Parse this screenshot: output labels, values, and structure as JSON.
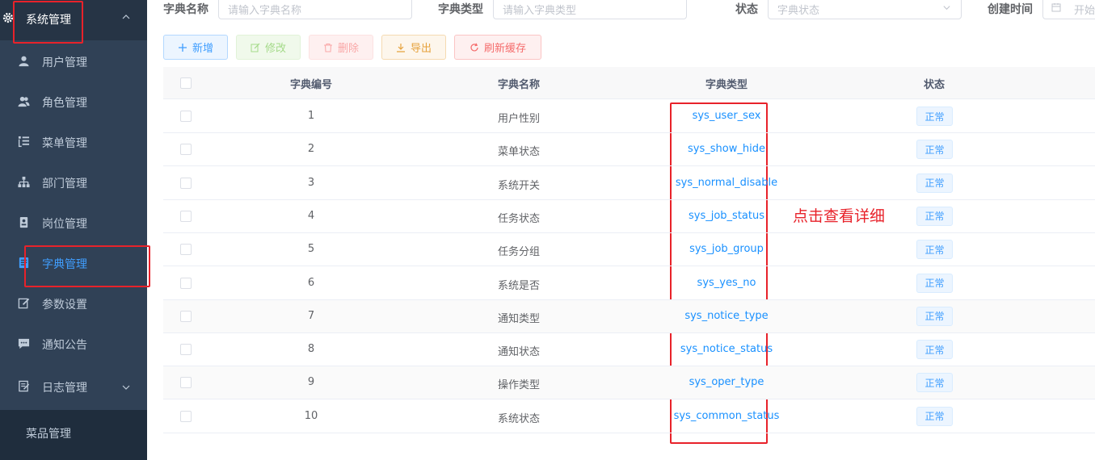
{
  "sidebar": {
    "header": "系统管理",
    "items": [
      {
        "label": "用户管理",
        "icon": "user-icon"
      },
      {
        "label": "角色管理",
        "icon": "peoples-icon"
      },
      {
        "label": "菜单管理",
        "icon": "tree-table-icon"
      },
      {
        "label": "部门管理",
        "icon": "tree-icon"
      },
      {
        "label": "岗位管理",
        "icon": "post-icon"
      },
      {
        "label": "字典管理",
        "icon": "dict-icon",
        "active": true
      },
      {
        "label": "参数设置",
        "icon": "edit-icon"
      },
      {
        "label": "通知公告",
        "icon": "message-icon"
      },
      {
        "label": "日志管理",
        "icon": "log-icon"
      }
    ],
    "submenu": "菜品管理"
  },
  "filters": {
    "dict_name_label": "字典名称",
    "dict_name_placeholder": "请输入字典名称",
    "dict_type_label": "字典类型",
    "dict_type_placeholder": "请输入字典类型",
    "status_label": "状态",
    "status_placeholder": "字典状态",
    "created_label": "创建时间",
    "created_placeholder": "开始"
  },
  "toolbar": {
    "add": "新增",
    "edit": "修改",
    "delete": "删除",
    "export": "导出",
    "refresh": "刷新缓存"
  },
  "table": {
    "headers": [
      "字典编号",
      "字典名称",
      "字典类型",
      "状态"
    ],
    "rows": [
      {
        "id": "1",
        "name": "用户性别",
        "type": "sys_user_sex",
        "status": "正常"
      },
      {
        "id": "2",
        "name": "菜单状态",
        "type": "sys_show_hide",
        "status": "正常"
      },
      {
        "id": "3",
        "name": "系统开关",
        "type": "sys_normal_disable",
        "status": "正常"
      },
      {
        "id": "4",
        "name": "任务状态",
        "type": "sys_job_status",
        "status": "正常"
      },
      {
        "id": "5",
        "name": "任务分组",
        "type": "sys_job_group",
        "status": "正常"
      },
      {
        "id": "6",
        "name": "系统是否",
        "type": "sys_yes_no",
        "status": "正常"
      },
      {
        "id": "7",
        "name": "通知类型",
        "type": "sys_notice_type",
        "status": "正常"
      },
      {
        "id": "8",
        "name": "通知状态",
        "type": "sys_notice_status",
        "status": "正常"
      },
      {
        "id": "9",
        "name": "操作类型",
        "type": "sys_oper_type",
        "status": "正常"
      },
      {
        "id": "10",
        "name": "系统状态",
        "type": "sys_common_status",
        "status": "正常"
      }
    ]
  },
  "annotation": "点击查看详细",
  "colors": {
    "sidebar_bg": "#304156",
    "accent": "#409eff",
    "annotation": "#e8222a"
  }
}
